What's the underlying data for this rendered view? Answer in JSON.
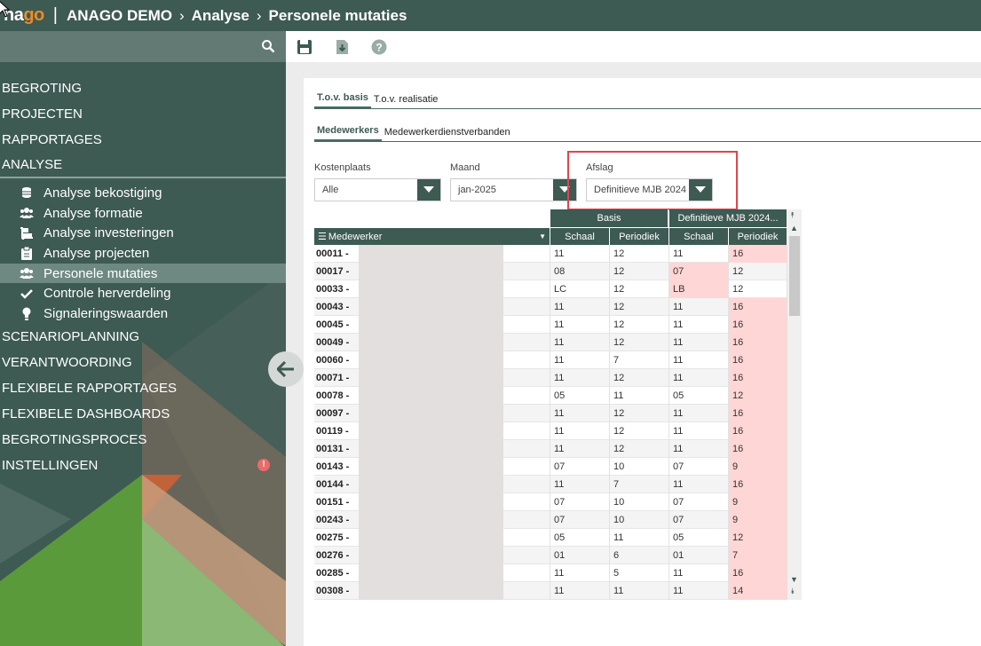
{
  "header": {
    "logo_prefix": "na",
    "logo_accent": "go",
    "crumbs": [
      "ANAGO DEMO",
      "Analyse",
      "Personele mutaties"
    ]
  },
  "sidebar": {
    "top_items": [
      {
        "label": "BEGROTING"
      },
      {
        "label": "PROJECTEN"
      },
      {
        "label": "RAPPORTAGES"
      },
      {
        "label": "ANALYSE"
      }
    ],
    "sub_items": [
      {
        "label": "Analyse bekostiging",
        "icon": "coins-icon"
      },
      {
        "label": "Analyse formatie",
        "icon": "users-icon"
      },
      {
        "label": "Analyse investeringen",
        "icon": "dolly-icon"
      },
      {
        "label": "Analyse projecten",
        "icon": "clipboard-icon"
      },
      {
        "label": "Personele mutaties",
        "icon": "users-icon",
        "active": true
      },
      {
        "label": "Controle herverdeling",
        "icon": "check-icon"
      },
      {
        "label": "Signaleringswaarden",
        "icon": "lightbulb-icon"
      }
    ],
    "bottom_items": [
      {
        "label": "SCENARIOPLANNING"
      },
      {
        "label": "VERANTWOORDING"
      },
      {
        "label": "FLEXIBELE RAPPORTAGES"
      },
      {
        "label": "FLEXIBELE DASHBOARDS"
      },
      {
        "label": "BEGROTINGSPROCES"
      },
      {
        "label": "INSTELLINGEN",
        "badge": "!"
      }
    ]
  },
  "toolbar": {
    "icons": [
      "save-icon",
      "download-icon",
      "help-icon"
    ]
  },
  "tabs_main": [
    "T.o.v. basis",
    "T.o.v. realisatie"
  ],
  "tabs_sub": [
    "Medewerkers",
    "Medewerkerdienstverbanden"
  ],
  "filters": {
    "kostenplaats": {
      "label": "Kostenplaats",
      "value": "Alle"
    },
    "maand": {
      "label": "Maand",
      "value": "jan-2025"
    },
    "afslag": {
      "label": "Afslag",
      "value": "Definitieve MJB 2024"
    }
  },
  "grid": {
    "group_basis": "Basis",
    "group_def": "Definitieve MJB 2024...",
    "col_medewerker": "Medewerker",
    "col_schaal": "Schaal",
    "col_periodiek": "Periodiek",
    "rows": [
      {
        "id": "00011 -",
        "bs": "11",
        "bp": "12",
        "ds": "11",
        "dp": "16",
        "ps": false,
        "pp": true
      },
      {
        "id": "00017 -",
        "bs": "08",
        "bp": "12",
        "ds": "07",
        "dp": "12",
        "ps": true,
        "pp": false
      },
      {
        "id": "00033 -",
        "bs": "LC",
        "bp": "12",
        "ds": "LB",
        "dp": "12",
        "ps": true,
        "pp": false
      },
      {
        "id": "00043 -",
        "bs": "11",
        "bp": "12",
        "ds": "11",
        "dp": "16",
        "ps": false,
        "pp": true
      },
      {
        "id": "00045 -",
        "bs": "11",
        "bp": "12",
        "ds": "11",
        "dp": "16",
        "ps": false,
        "pp": true
      },
      {
        "id": "00049 -",
        "bs": "11",
        "bp": "12",
        "ds": "11",
        "dp": "16",
        "ps": false,
        "pp": true
      },
      {
        "id": "00060 -",
        "bs": "11",
        "bp": "7",
        "ds": "11",
        "dp": "16",
        "ps": false,
        "pp": true
      },
      {
        "id": "00071 -",
        "bs": "11",
        "bp": "12",
        "ds": "11",
        "dp": "16",
        "ps": false,
        "pp": true
      },
      {
        "id": "00078 -",
        "bs": "05",
        "bp": "11",
        "ds": "05",
        "dp": "12",
        "ps": false,
        "pp": true
      },
      {
        "id": "00097 -",
        "bs": "11",
        "bp": "12",
        "ds": "11",
        "dp": "16",
        "ps": false,
        "pp": true
      },
      {
        "id": "00119 -",
        "bs": "11",
        "bp": "12",
        "ds": "11",
        "dp": "16",
        "ps": false,
        "pp": true
      },
      {
        "id": "00131 -",
        "bs": "11",
        "bp": "12",
        "ds": "11",
        "dp": "16",
        "ps": false,
        "pp": true
      },
      {
        "id": "00143 -",
        "bs": "07",
        "bp": "10",
        "ds": "07",
        "dp": "9",
        "ps": false,
        "pp": true
      },
      {
        "id": "00144 -",
        "bs": "11",
        "bp": "7",
        "ds": "11",
        "dp": "16",
        "ps": false,
        "pp": true
      },
      {
        "id": "00151 -",
        "bs": "07",
        "bp": "10",
        "ds": "07",
        "dp": "9",
        "ps": false,
        "pp": true
      },
      {
        "id": "00243 -",
        "bs": "07",
        "bp": "10",
        "ds": "07",
        "dp": "9",
        "ps": false,
        "pp": true
      },
      {
        "id": "00275 -",
        "bs": "05",
        "bp": "11",
        "ds": "05",
        "dp": "12",
        "ps": false,
        "pp": true
      },
      {
        "id": "00276 -",
        "bs": "01",
        "bp": "6",
        "ds": "01",
        "dp": "7",
        "ps": false,
        "pp": true
      },
      {
        "id": "00285 -",
        "bs": "11",
        "bp": "5",
        "ds": "11",
        "dp": "16",
        "ps": false,
        "pp": true
      },
      {
        "id": "00308 -",
        "bs": "11",
        "bp": "11",
        "ds": "11",
        "dp": "14",
        "ps": false,
        "pp": true
      }
    ]
  }
}
